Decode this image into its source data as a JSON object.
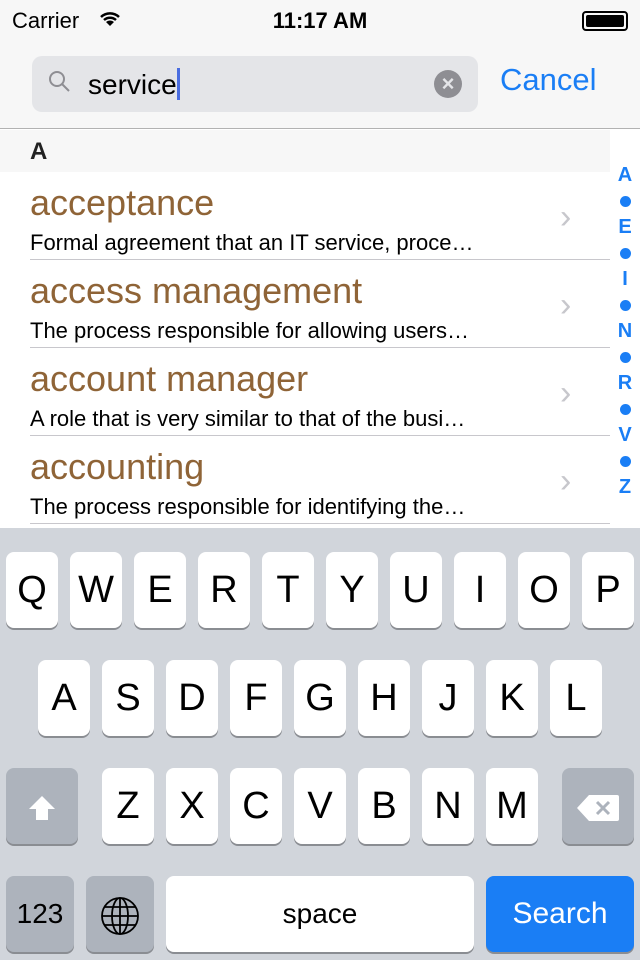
{
  "status": {
    "carrier": "Carrier",
    "time": "11:17 AM"
  },
  "search": {
    "value": "service",
    "cancel": "Cancel"
  },
  "section": "A",
  "items": [
    {
      "title": "acceptance",
      "desc": "Formal agreement that an IT service, proce…"
    },
    {
      "title": "access management",
      "desc": "The process responsible for allowing users…"
    },
    {
      "title": "account manager",
      "desc": "A role that is very similar to that of the busi…"
    },
    {
      "title": "accounting",
      "desc": "The process responsible for identifying the…"
    }
  ],
  "index": [
    "A",
    "E",
    "I",
    "N",
    "R",
    "V",
    "Z"
  ],
  "keyboard": {
    "row1": [
      "Q",
      "W",
      "E",
      "R",
      "T",
      "Y",
      "U",
      "I",
      "O",
      "P"
    ],
    "row2": [
      "A",
      "S",
      "D",
      "F",
      "G",
      "H",
      "J",
      "K",
      "L"
    ],
    "row3": [
      "Z",
      "X",
      "C",
      "V",
      "B",
      "N",
      "M"
    ],
    "numbers": "123",
    "space": "space",
    "search": "Search"
  },
  "colors": {
    "accent": "#1a7ef5",
    "title": "#8f6437"
  }
}
